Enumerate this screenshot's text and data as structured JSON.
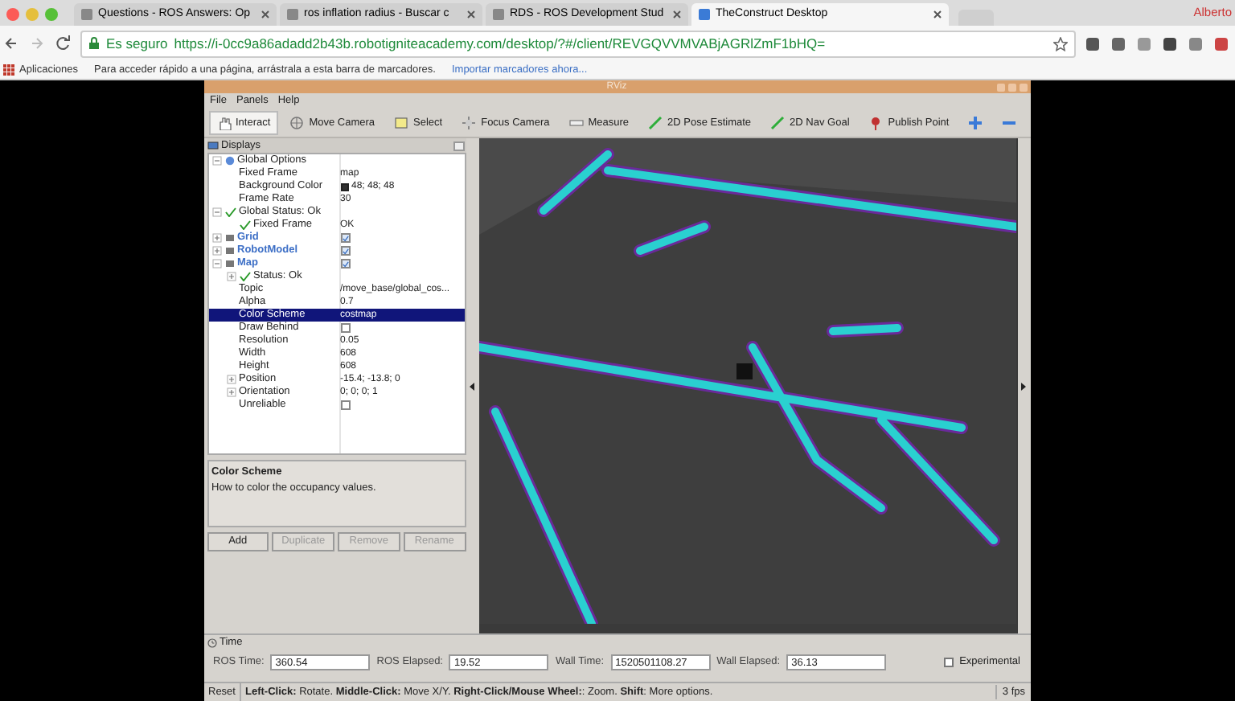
{
  "browser": {
    "tabs": [
      {
        "title": "Questions - ROS Answers: Op",
        "selected": false
      },
      {
        "title": "ros inflation radius - Buscar c",
        "selected": false
      },
      {
        "title": "RDS - ROS Development Stud",
        "selected": false
      },
      {
        "title": "TheConstruct Desktop",
        "selected": true
      }
    ],
    "profile": "Alberto",
    "secure_label": "Es seguro",
    "url": "https://i-0cc9a86adadd2b43b.robotigniteacademy.com/desktop/?#/client/REVGQVVMVABjAGRlZmF1bHQ=",
    "bookmarks": {
      "apps": "Aplicaciones",
      "hint": "Para acceder rápido a una página, arrástrala a esta barra de marcadores.",
      "import_link": "Importar marcadores ahora..."
    }
  },
  "rviz": {
    "title": "RViz",
    "menu": [
      "File",
      "Panels",
      "Help"
    ],
    "tools": [
      {
        "label": "Interact",
        "kind": "hand",
        "selected": true
      },
      {
        "label": "Move Camera",
        "kind": "camera",
        "selected": false
      },
      {
        "label": "Select",
        "kind": "select",
        "selected": false
      },
      {
        "label": "Focus Camera",
        "kind": "focus",
        "selected": false
      },
      {
        "label": "Measure",
        "kind": "ruler",
        "selected": false
      },
      {
        "label": "2D Pose Estimate",
        "kind": "arrow",
        "selected": false
      },
      {
        "label": "2D Nav Goal",
        "kind": "arrow",
        "selected": false
      },
      {
        "label": "Publish Point",
        "kind": "pin",
        "selected": false
      },
      {
        "kind": "plus",
        "selected": false
      },
      {
        "kind": "minus",
        "selected": false
      }
    ],
    "displays": {
      "title": "Displays",
      "tree": [
        {
          "kind": "group",
          "label": "Global Options",
          "expanded": true,
          "children": [
            {
              "kind": "property",
              "label": "Fixed Frame",
              "value": "map"
            },
            {
              "kind": "property",
              "label": "Background Color",
              "value": "48; 48; 48",
              "color": "#303030"
            },
            {
              "kind": "property",
              "label": "Frame Rate",
              "value": "30"
            }
          ]
        },
        {
          "kind": "status",
          "label": "Global Status: Ok",
          "expanded": true,
          "children": [
            {
              "kind": "status",
              "label": "Fixed Frame",
              "value": "OK"
            }
          ]
        },
        {
          "kind": "display",
          "label": "Grid",
          "expanded": false,
          "checked": true
        },
        {
          "kind": "display",
          "label": "RobotModel",
          "expanded": false,
          "checked": true
        },
        {
          "kind": "display",
          "label": "Map",
          "expanded": true,
          "checked": true,
          "children": [
            {
              "kind": "status",
              "label": "Status: Ok",
              "expanded": false
            },
            {
              "kind": "property",
              "label": "Topic",
              "value": "/move_base/global_cos..."
            },
            {
              "kind": "property",
              "label": "Alpha",
              "value": "0.7"
            },
            {
              "kind": "property",
              "label": "Color Scheme",
              "value": "costmap",
              "selected": true
            },
            {
              "kind": "property",
              "label": "Draw Behind",
              "checked": false
            },
            {
              "kind": "property",
              "label": "Resolution",
              "value": "0.05"
            },
            {
              "kind": "property",
              "label": "Width",
              "value": "608"
            },
            {
              "kind": "property",
              "label": "Height",
              "value": "608"
            },
            {
              "kind": "property",
              "label": "Position",
              "value": "-15.4; -13.8; 0",
              "expanded": false
            },
            {
              "kind": "property",
              "label": "Orientation",
              "value": "0; 0; 0; 1",
              "expanded": false
            },
            {
              "kind": "property",
              "label": "Unreliable",
              "checked": false
            }
          ]
        }
      ],
      "help_title": "Color Scheme",
      "help_text": "How to color the occupancy values.",
      "buttons": [
        {
          "label": "Add",
          "disabled": false
        },
        {
          "label": "Duplicate",
          "disabled": true
        },
        {
          "label": "Remove",
          "disabled": true
        },
        {
          "label": "Rename",
          "disabled": true
        }
      ]
    },
    "time": {
      "title": "Time",
      "fields": [
        {
          "label": "ROS Time:",
          "value": "360.54"
        },
        {
          "label": "ROS Elapsed:",
          "value": "19.52"
        },
        {
          "label": "Wall Time:",
          "value": "1520501108.27"
        },
        {
          "label": "Wall Elapsed:",
          "value": "36.13"
        }
      ],
      "experimental": {
        "label": "Experimental",
        "checked": false
      }
    },
    "status_bar": {
      "reset": "Reset",
      "help": "**Left-Click:** Rotate. **Middle-Click:** Move X/Y. **Right-Click/Mouse Wheel:**: Zoom. **Shift**: More options.",
      "fps": "3 fps"
    }
  }
}
